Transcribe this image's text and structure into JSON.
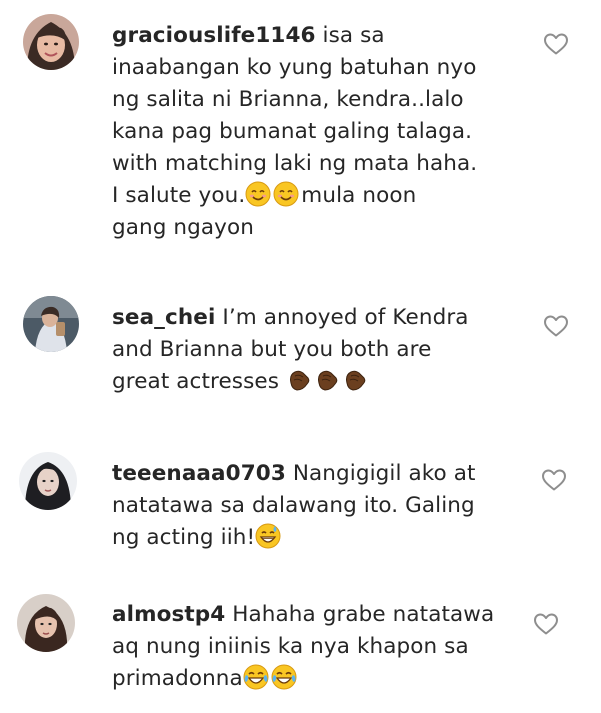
{
  "comments": [
    {
      "username": "graciouslife1146",
      "lines": [
        " isa sa",
        "inaabangan ko yung batuhan nyo",
        "ng salita ni Brianna, kendra..lalo",
        "kana pag bumanat galing talaga.",
        "with matching laki ng mata haha.",
        "I salute you.",
        "mula noon",
        "gang ngayon"
      ],
      "emoji": [
        "smiling-face-emoji",
        "smiling-face-emoji"
      ],
      "like_icon": "heart-outline-icon"
    },
    {
      "username": "sea_chei",
      "lines": [
        " I’m annoyed of Kendra",
        "and Brianna but you both are",
        "great actresses"
      ],
      "emoji": [
        "clapping-hands-emoji",
        "clapping-hands-emoji",
        "clapping-hands-emoji"
      ],
      "like_icon": "heart-outline-icon"
    },
    {
      "username": "teeenaaa0703",
      "lines": [
        " Nangigigil ako at",
        "natatawa sa dalawang ito. Galing",
        "ng acting iih!"
      ],
      "emoji": [
        "grinning-sweat-emoji"
      ],
      "like_icon": "heart-outline-icon"
    },
    {
      "username": "almostp4",
      "lines": [
        " Hahaha grabe natatawa",
        "aq nung iniinis ka nya khapon sa",
        "primadonna"
      ],
      "emoji": [
        "tears-of-joy-emoji",
        "tears-of-joy-emoji"
      ],
      "like_icon": "heart-outline-icon"
    }
  ],
  "colors": {
    "text": "#262626",
    "heart_stroke": "#8e8e8e",
    "background": "#ffffff"
  }
}
